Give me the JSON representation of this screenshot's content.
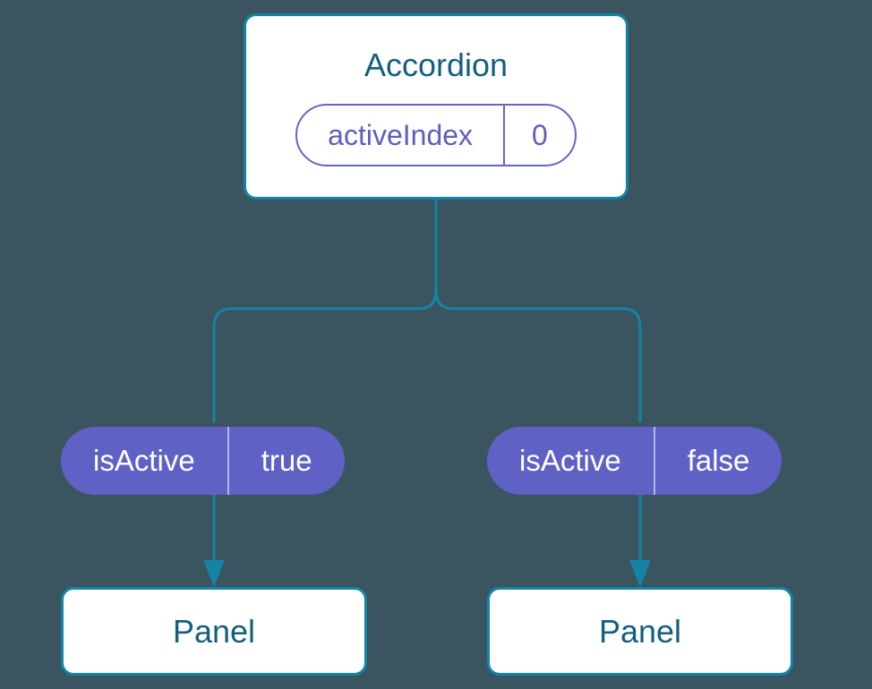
{
  "diagram": {
    "root": {
      "title": "Accordion",
      "state": {
        "label": "activeIndex",
        "value": "0"
      }
    },
    "children": [
      {
        "prop": {
          "label": "isActive",
          "value": "true"
        },
        "panel": {
          "label": "Panel"
        }
      },
      {
        "prop": {
          "label": "isActive",
          "value": "false"
        },
        "panel": {
          "label": "Panel"
        }
      }
    ],
    "colors": {
      "background": "#3a5460",
      "box_border": "#1285a5",
      "box_text": "#13607e",
      "pill_border": "#6366c9",
      "pill_text": "#5e5fbc",
      "prop_bg": "#5f61c4",
      "prop_text": "#ffffff"
    }
  }
}
